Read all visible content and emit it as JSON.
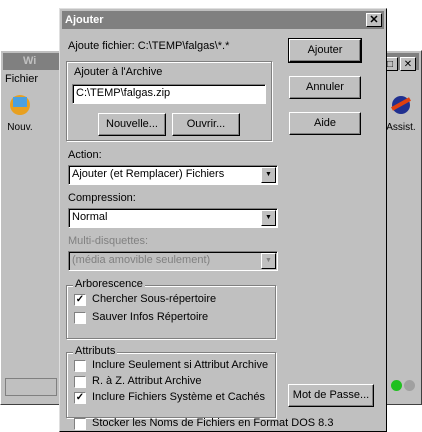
{
  "background": {
    "title_partial": "Wi",
    "menu_partial": "Fichier",
    "toolbar": {
      "new_label": "Nouv.",
      "assist_label": "Assist."
    },
    "win_buttons": [
      "□",
      "✕"
    ]
  },
  "dialog": {
    "title": "Ajouter",
    "close_glyph": "✕",
    "add_file_text": "Ajoute fichier: C:\\TEMP\\falgas\\*.*",
    "archive_group_label": "Ajouter à l'Archive",
    "archive_path": "C:\\TEMP\\falgas.zip",
    "new_button": "Nouvelle...",
    "open_button": "Ouvrir...",
    "add_button": "Ajouter",
    "cancel_button": "Annuler",
    "help_button": "Aide",
    "action_label": "Action:",
    "action_value": "Ajouter (et Remplacer) Fichiers",
    "compression_label": "Compression:",
    "compression_value": "Normal",
    "multi_label": "Multi-disquettes:",
    "multi_value": "(média amovible seulement)",
    "tree_group_label": "Arborescence",
    "tree_options": [
      {
        "label": "Chercher Sous-répertoire",
        "checked": true
      },
      {
        "label": "Sauver Infos Répertoire",
        "checked": false
      }
    ],
    "attr_group_label": "Attributs",
    "attr_options": [
      {
        "label": "Inclure Seulement si Attribut Archive",
        "checked": false
      },
      {
        "label": "R. à Z. Attribut Archive",
        "checked": false
      },
      {
        "label": "Inclure Fichiers Système et Cachés",
        "checked": true
      }
    ],
    "password_button": "Mot de Passe...",
    "dos_option": {
      "label": "Stocker les Noms de Fichiers en Format DOS 8.3",
      "checked": false
    },
    "checkmark": "✓",
    "dropdown_arrow": "▼"
  }
}
